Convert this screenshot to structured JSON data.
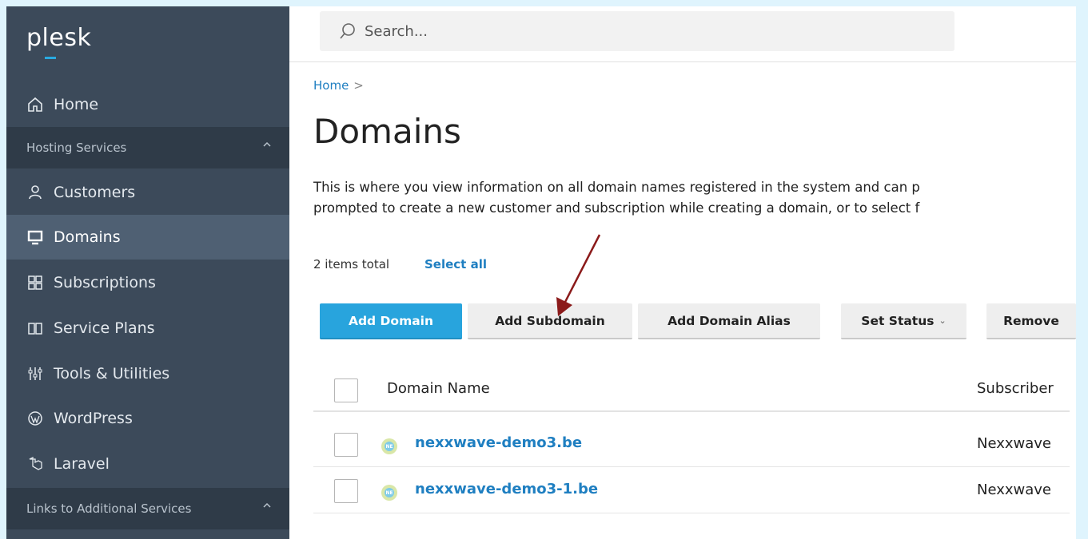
{
  "sidebar": {
    "logo": "plesk",
    "items": [
      {
        "label": "Home"
      },
      {
        "label": "Customers"
      },
      {
        "label": "Domains"
      },
      {
        "label": "Subscriptions"
      },
      {
        "label": "Service Plans"
      },
      {
        "label": "Tools & Utilities"
      },
      {
        "label": "WordPress"
      },
      {
        "label": "Laravel"
      }
    ],
    "sections": {
      "hosting": "Hosting Services",
      "links": "Links to Additional Services"
    }
  },
  "search": {
    "placeholder": "Search..."
  },
  "breadcrumb": {
    "home": "Home",
    "separator": ">"
  },
  "page": {
    "title": "Domains",
    "description_line1": "This is where you view information on all domain names registered in the system and can p",
    "description_line2": "prompted to create a new customer and subscription while creating a domain, or to select f"
  },
  "list": {
    "items_total": "2 items total",
    "select_all": "Select all"
  },
  "toolbar": {
    "add_domain": "Add Domain",
    "add_subdomain": "Add Subdomain",
    "add_domain_alias": "Add Domain Alias",
    "set_status": "Set Status",
    "remove": "Remove"
  },
  "table": {
    "columns": [
      "Domain Name",
      "Subscriber"
    ],
    "rows": [
      {
        "domain": "nexxwave-demo3.be",
        "subscriber": "Nexxwave",
        "icon_text": "NE"
      },
      {
        "domain": "nexxwave-demo3-1.be",
        "subscriber": "Nexxwave",
        "icon_text": "NE"
      }
    ]
  },
  "colors": {
    "sidebar_bg": "#3c4a5a",
    "accent": "#28a4dd",
    "link": "#1f7fc1",
    "annotation_arrow": "#8b1a1a"
  }
}
